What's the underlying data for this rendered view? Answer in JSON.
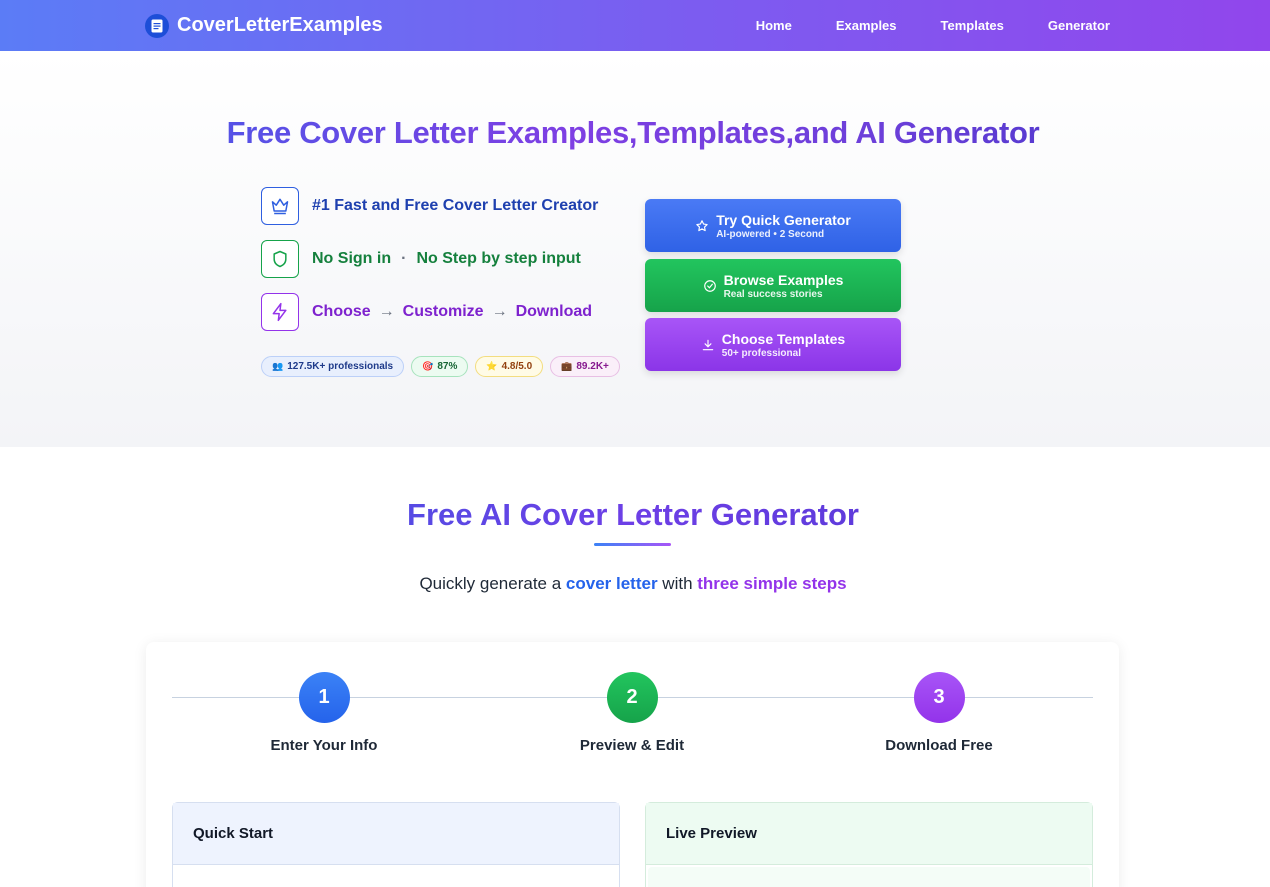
{
  "nav": {
    "brand": "CoverLetterExamples",
    "links": [
      "Home",
      "Examples",
      "Templates",
      "Generator"
    ]
  },
  "hero": {
    "title": "Free Cover Letter Examples,Templates,and AI Generator",
    "features": {
      "f1": "#1 Fast and Free Cover Letter Creator",
      "f2a": "No Sign in",
      "f2sep": "·",
      "f2b": "No Step by step input",
      "f3a": "Choose",
      "f3b": "Customize",
      "f3c": "Download",
      "arrow": "→"
    },
    "badges": [
      "127.5K+ professionals",
      "87%",
      "4.8/5.0",
      "89.2K+"
    ],
    "cta": [
      {
        "label": "Try Quick Generator",
        "sub": "AI-powered • 2 Second"
      },
      {
        "label": "Browse Examples",
        "sub": "Real success stories"
      },
      {
        "label": "Choose Templates",
        "sub": "50+ professional"
      }
    ]
  },
  "generator": {
    "title": "Free AI Cover Letter Generator",
    "sub_prefix": "Quickly generate a ",
    "sub_hl1": "cover letter",
    "sub_mid": " with ",
    "sub_hl2": "three simple steps",
    "steps": [
      {
        "num": "1",
        "label": "Enter Your Info"
      },
      {
        "num": "2",
        "label": "Preview & Edit"
      },
      {
        "num": "3",
        "label": "Download Free"
      }
    ],
    "panels": {
      "left": "Quick Start",
      "right": "Live Preview"
    }
  },
  "colors": {
    "blue": "#2563eb",
    "green": "#16a34a",
    "purple": "#9333ea"
  }
}
